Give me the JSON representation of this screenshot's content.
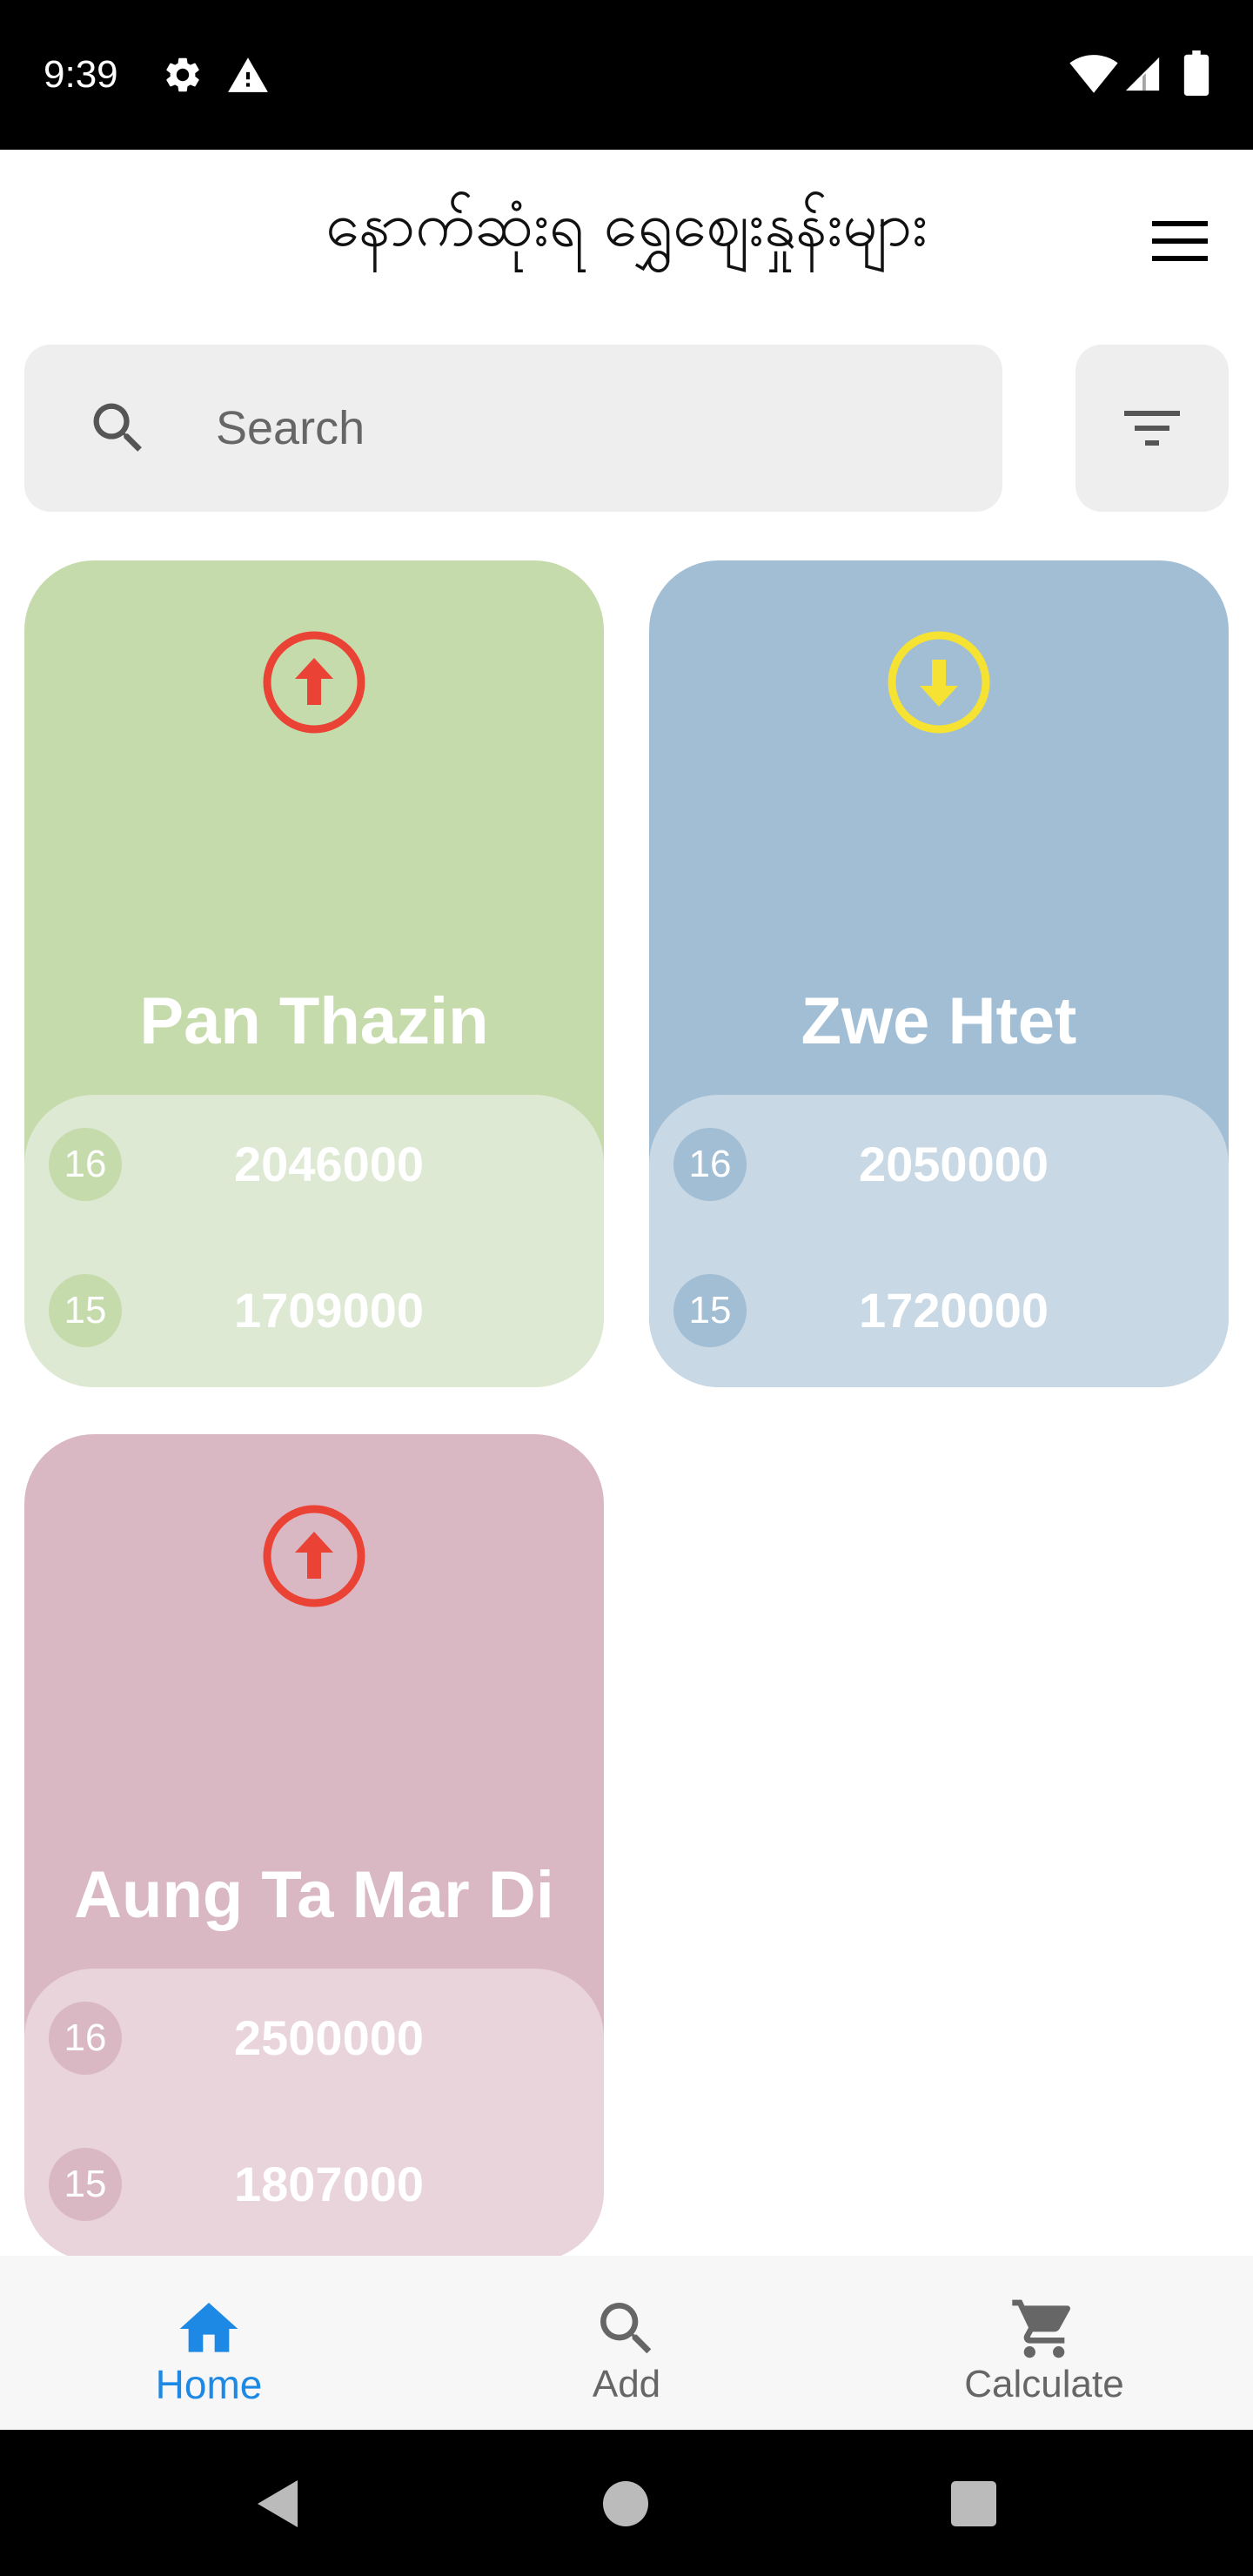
{
  "status_bar": {
    "time": "9:39",
    "icons": [
      "gear-icon",
      "alert-icon",
      "wifi-icon",
      "signal-icon",
      "battery-icon"
    ]
  },
  "header": {
    "title": "နောက်ဆုံးရ ရွှေဈေးနှုန်းများ",
    "menu_icon": "hamburger-menu-icon"
  },
  "search": {
    "placeholder": "Search",
    "value": "",
    "icon": "search-icon",
    "filter_icon": "filter-icon"
  },
  "colors": {
    "card_green": "#c6dbab",
    "card_blue": "#a2bed4",
    "card_pink": "#d9b8c3",
    "arrow_up": "#ea4335",
    "arrow_down": "#f5e232",
    "nav_active": "#1e88e5",
    "nav_inactive": "#666666"
  },
  "shops": [
    {
      "name": "Pan Thazin",
      "trend": "up",
      "trend_icon": "arrow-up-circle-icon",
      "prices": [
        {
          "grade": "16",
          "price": "2046000"
        },
        {
          "grade": "15",
          "price": "1709000"
        }
      ]
    },
    {
      "name": "Zwe Htet",
      "trend": "down",
      "trend_icon": "arrow-down-circle-icon",
      "prices": [
        {
          "grade": "16",
          "price": "2050000"
        },
        {
          "grade": "15",
          "price": "1720000"
        }
      ]
    },
    {
      "name": "Aung Ta Mar Di",
      "trend": "up",
      "trend_icon": "arrow-up-circle-icon",
      "prices": [
        {
          "grade": "16",
          "price": "2500000"
        },
        {
          "grade": "15",
          "price": "1807000"
        }
      ]
    }
  ],
  "bottom_nav": {
    "items": [
      {
        "label": "Home",
        "icon": "home-icon",
        "active": true
      },
      {
        "label": "Add",
        "icon": "search-icon",
        "active": false
      },
      {
        "label": "Calculate",
        "icon": "cart-icon",
        "active": false
      }
    ]
  },
  "system_nav": {
    "icons": [
      "back-icon",
      "home-circle-icon",
      "recents-icon"
    ]
  }
}
